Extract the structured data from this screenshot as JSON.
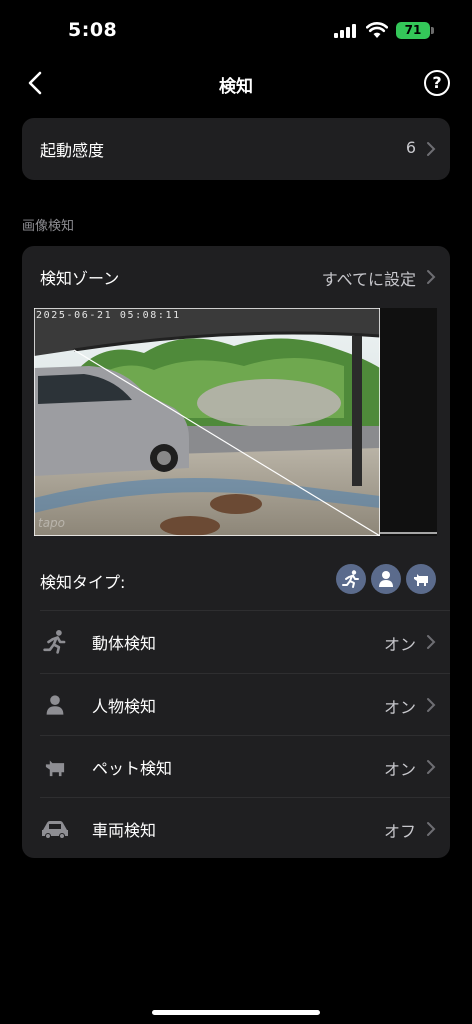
{
  "status_bar": {
    "time": "5:08",
    "battery": "71"
  },
  "nav": {
    "title": "検知"
  },
  "sensitivity": {
    "label": "起動感度",
    "value": "6"
  },
  "section_label": "画像検知",
  "detection_zone": {
    "label": "検知ゾーン",
    "value": "すべてに設定"
  },
  "preview": {
    "timestamp": "2025-06-21 05:08:11",
    "logo": "tapo"
  },
  "detection_types": {
    "label": "検知タイプ:",
    "badges": [
      "motion-icon",
      "person-icon",
      "pet-icon"
    ],
    "items": [
      {
        "icon": "motion-icon",
        "label": "動体検知",
        "value": "オン"
      },
      {
        "icon": "person-icon",
        "label": "人物検知",
        "value": "オン"
      },
      {
        "icon": "pet-icon",
        "label": "ペット検知",
        "value": "オン"
      },
      {
        "icon": "vehicle-icon",
        "label": "車両検知",
        "value": "オフ"
      }
    ]
  },
  "colors": {
    "background": "#000000",
    "card": "#1f1f21",
    "badge": "#5b6b8c",
    "battery": "#34c759",
    "secondary_text": "#c7c7cc"
  }
}
